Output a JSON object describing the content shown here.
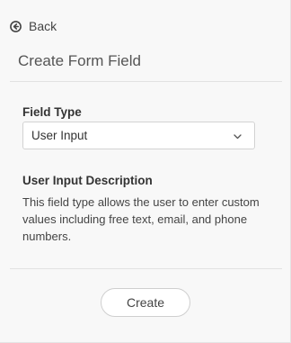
{
  "nav": {
    "back_label": "Back",
    "back_icon": "circle-arrow-left-icon"
  },
  "page": {
    "title": "Create Form Field"
  },
  "field_type": {
    "label": "Field Type",
    "selected": "User Input",
    "dropdown_icon": "chevron-down-icon"
  },
  "description": {
    "heading": "User Input Description",
    "text": "This field type allows the user to enter custom values including free text, email, and phone numbers."
  },
  "actions": {
    "create_label": "Create"
  },
  "colors": {
    "panel_background": "#f8f8f8",
    "text": "#444444",
    "border": "#d2d2d2"
  }
}
